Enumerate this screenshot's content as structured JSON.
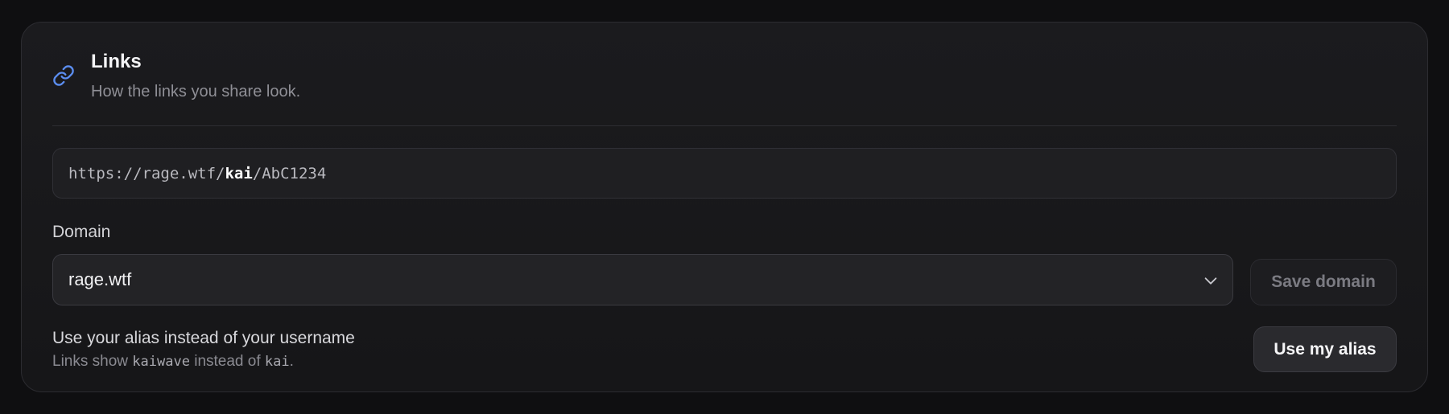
{
  "header": {
    "icon": "link-icon",
    "title": "Links",
    "subtitle": "How the links you share look."
  },
  "preview": {
    "prefix": "https://rage.wtf/",
    "highlight": "kai",
    "suffix": "/AbC1234"
  },
  "domain": {
    "label": "Domain",
    "selected": "rage.wtf",
    "chevron_icon": "chevron-down-icon",
    "save_label": "Save domain"
  },
  "alias": {
    "title": "Use your alias instead of your username",
    "desc_before": "Links show ",
    "alias_name": "kaiwave",
    "desc_middle": " instead of ",
    "username": "kai",
    "desc_after": ".",
    "button_label": "Use my alias"
  },
  "colors": {
    "accent": "#5b8def",
    "background": "#0f0f11",
    "card": "#1b1b1e"
  }
}
